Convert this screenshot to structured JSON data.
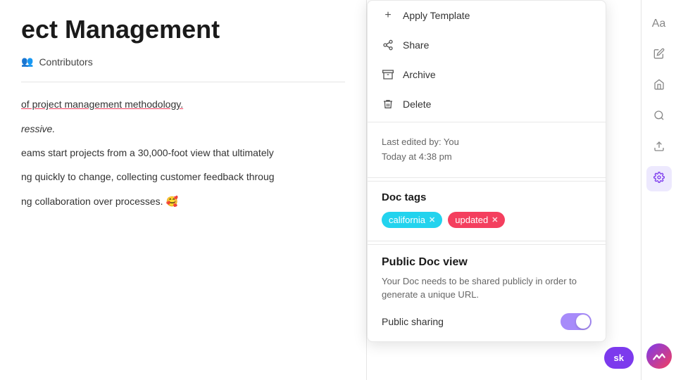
{
  "page": {
    "title": "ect Management",
    "full_title": "Project Management"
  },
  "contributors": {
    "label": "Contributors",
    "icon": "👥"
  },
  "body": {
    "line1": "of project management methodology.",
    "line2": "ressive.",
    "line3": "eams start projects from a 30,000-foot view that ultimately",
    "line4": "ng quickly to change, collecting customer feedback throug",
    "line5": "ng collaboration over processes. 🥰"
  },
  "menu": {
    "items": [
      {
        "id": "apply-template",
        "icon": "+",
        "label": "Apply Template"
      },
      {
        "id": "share",
        "icon": "share",
        "label": "Share"
      },
      {
        "id": "archive",
        "icon": "archive",
        "label": "Archive"
      },
      {
        "id": "delete",
        "icon": "delete",
        "label": "Delete"
      }
    ]
  },
  "last_edited": {
    "line1": "Last edited by: You",
    "line2": "Today at 4:38 pm"
  },
  "doc_tags": {
    "title": "Doc tags",
    "tags": [
      {
        "id": "california",
        "label": "california",
        "color": "cyan"
      },
      {
        "id": "updated",
        "label": "updated",
        "color": "pink"
      }
    ]
  },
  "public_doc": {
    "title": "Public Doc view",
    "description": "Your Doc needs to be shared publicly in order to generate a unique URL.",
    "sharing_label": "Public sharing",
    "toggle_on": true
  },
  "sidebar_icons": [
    {
      "id": "font",
      "symbol": "Aa",
      "active": false
    },
    {
      "id": "edit",
      "symbol": "✏",
      "active": false
    },
    {
      "id": "home",
      "symbol": "⌂",
      "active": false
    },
    {
      "id": "search",
      "symbol": "◯",
      "active": false
    },
    {
      "id": "upload",
      "symbol": "↑",
      "active": false
    },
    {
      "id": "settings",
      "symbol": "⚙",
      "active": true
    }
  ],
  "task_btn": {
    "label": "sk"
  }
}
